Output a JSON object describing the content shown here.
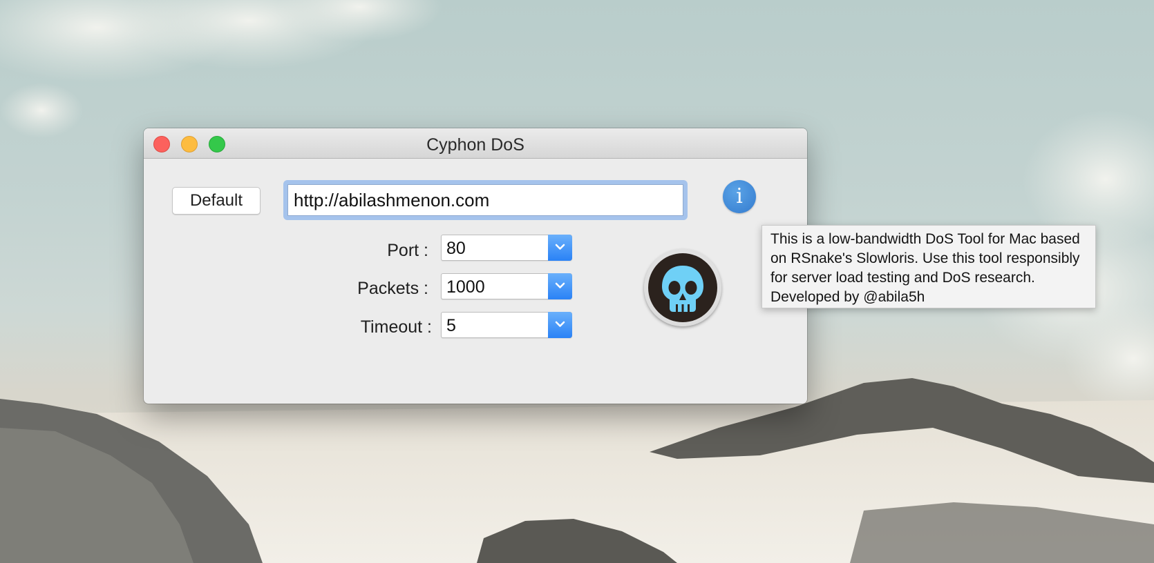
{
  "window": {
    "title": "Cyphon DoS"
  },
  "toolbar": {
    "default_label": "Default",
    "url_value": "http://abilashmenon.com",
    "info_icon_glyph": "i"
  },
  "form": {
    "fields": [
      {
        "label": "Port :",
        "value": "80"
      },
      {
        "label": "Packets :",
        "value": "1000"
      },
      {
        "label": "Timeout :",
        "value": "5"
      }
    ]
  },
  "icons": {
    "info": "info-icon",
    "skull": "skull-icon",
    "chevron": "chevron-down-icon"
  },
  "tooltip": {
    "text": "This is a low-bandwidth DoS Tool for Mac based on RSnake's Slowloris. Use this tool responsibly for server load testing and DoS research. Developed by @abila5h"
  },
  "colors": {
    "accent": "#2a82f6",
    "info": "#3f87d6",
    "skull": "#6fd0f6",
    "close": "#fc615d",
    "minimize": "#fdbc40",
    "zoom": "#34c84a"
  }
}
